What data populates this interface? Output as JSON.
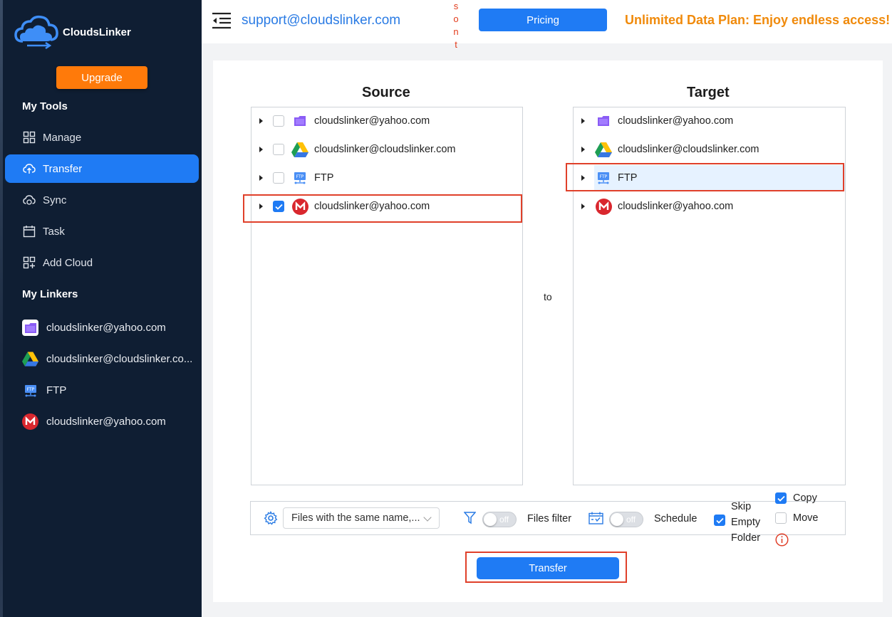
{
  "sidebar": {
    "brand": "CloudsLinker",
    "upgrade_label": "Upgrade",
    "my_tools_title": "My Tools",
    "tools": [
      {
        "label": "Manage",
        "icon": "grid-icon"
      },
      {
        "label": "Transfer",
        "icon": "cloud-upload-icon",
        "active": true
      },
      {
        "label": "Sync",
        "icon": "cloud-sync-icon"
      },
      {
        "label": "Task",
        "icon": "calendar-icon"
      },
      {
        "label": "Add Cloud",
        "icon": "add-grid-icon"
      }
    ],
    "my_linkers_title": "My Linkers",
    "linkers": [
      {
        "label": "cloudslinker@yahoo.com",
        "icon": "purple-folder-icon"
      },
      {
        "label": "cloudslinker@cloudslinker.co...",
        "icon": "google-drive-icon"
      },
      {
        "label": "FTP",
        "icon": "ftp-icon"
      },
      {
        "label": "cloudslinker@yahoo.com",
        "icon": "mega-icon"
      }
    ]
  },
  "header": {
    "email": "support@cloudslinker.com",
    "vertical_text": [
      "s",
      "o",
      "n",
      "t"
    ],
    "pricing_label": "Pricing",
    "promo": "Unlimited Data Plan: Enjoy endless access!"
  },
  "main": {
    "source_title": "Source",
    "target_title": "Target",
    "to_label": "to",
    "source_items": [
      {
        "label": "cloudslinker@yahoo.com",
        "icon": "purple-folder-icon",
        "checked": false
      },
      {
        "label": "cloudslinker@cloudslinker.com",
        "icon": "google-drive-icon",
        "checked": false
      },
      {
        "label": "FTP",
        "icon": "ftp-icon",
        "checked": false
      },
      {
        "label": "cloudslinker@yahoo.com",
        "icon": "mega-icon",
        "checked": true
      }
    ],
    "target_items": [
      {
        "label": "cloudslinker@yahoo.com",
        "icon": "purple-folder-icon"
      },
      {
        "label": "cloudslinker@cloudslinker.com",
        "icon": "google-drive-icon"
      },
      {
        "label": "FTP",
        "icon": "ftp-icon",
        "selected": true
      },
      {
        "label": "cloudslinker@yahoo.com",
        "icon": "mega-icon"
      }
    ]
  },
  "options": {
    "same_name_select": "Files with the same name,...",
    "filter_toggle": "off",
    "files_filter_label": "Files filter",
    "schedule_toggle": "off",
    "schedule_label": "Schedule",
    "skip_empty_lines": [
      "Skip",
      "Empty",
      "Folder"
    ],
    "skip_empty_checked": true,
    "copy_label": "Copy",
    "copy_checked": true,
    "move_label": "Move",
    "move_checked": false
  },
  "transfer_label": "Transfer",
  "colors": {
    "accent": "#1f7bf4",
    "sidebar_bg": "#0f1e33",
    "upgrade": "#ff7a0a",
    "promo": "#f08a0b",
    "highlight_border": "#e0402a"
  }
}
